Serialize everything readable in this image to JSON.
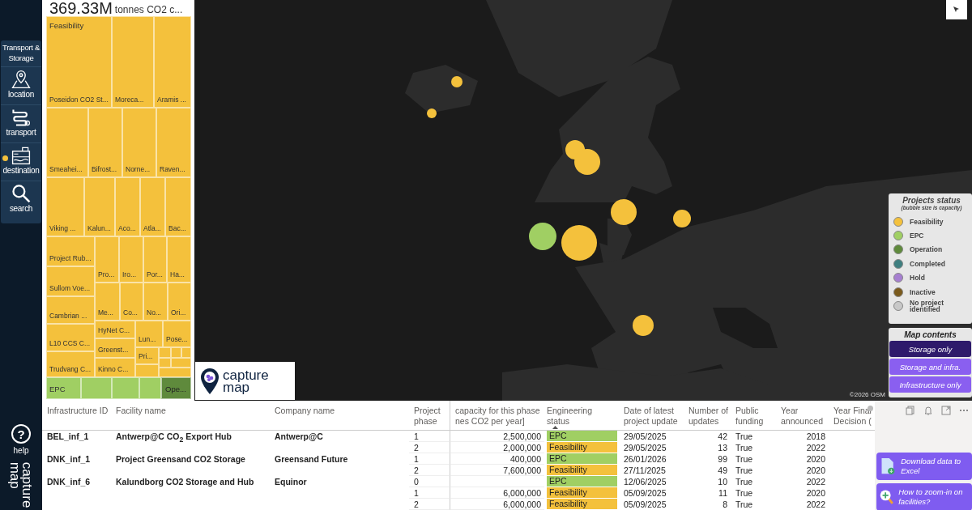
{
  "sidebar": {
    "nav_title": "Transport & Storage",
    "nav_items": [
      {
        "label": "location",
        "kind": "location",
        "selected": false
      },
      {
        "label": "transport",
        "kind": "transport",
        "selected": false
      },
      {
        "label": "destination",
        "kind": "destination",
        "selected": true
      },
      {
        "label": "search",
        "kind": "search",
        "selected": false
      }
    ],
    "help": {
      "glyph": "?",
      "label": "help"
    },
    "logo_lines": [
      "capture",
      "map"
    ]
  },
  "summary": {
    "value": "369.33M",
    "unit": "tonnes CO2 c..."
  },
  "treemap": {
    "groups": [
      {
        "label": "Feasibility",
        "color": "#f4c13c",
        "cells": [
          {
            "label": "Poseidon CO2 St..."
          },
          {
            "label": "Moreca..."
          },
          {
            "label": "Aramis ..."
          },
          {
            "label": "Smeahei..."
          },
          {
            "label": "Bifrost..."
          },
          {
            "label": "Norne..."
          },
          {
            "label": "Raven..."
          },
          {
            "label": "Viking ..."
          },
          {
            "label": "Kalun..."
          },
          {
            "label": "Aco..."
          },
          {
            "label": "Atla..."
          },
          {
            "label": "Bac..."
          },
          {
            "label": "Project Rub..."
          },
          {
            "label": "Sullom Voe..."
          },
          {
            "label": "Cambrian ..."
          },
          {
            "label": "L10 CCS C..."
          },
          {
            "label": "Trudvang C..."
          },
          {
            "label": "Pro..."
          },
          {
            "label": "Iro..."
          },
          {
            "label": "Por..."
          },
          {
            "label": "Ha..."
          },
          {
            "label": "Me..."
          },
          {
            "label": "Co..."
          },
          {
            "label": "No..."
          },
          {
            "label": "Ori..."
          },
          {
            "label": "HyNet C..."
          },
          {
            "label": "Greenst..."
          },
          {
            "label": "Kinno C..."
          },
          {
            "label": "Lun..."
          },
          {
            "label": "Pose..."
          },
          {
            "label": "Pri..."
          },
          {},
          {},
          {},
          {},
          {},
          {},
          {}
        ]
      },
      {
        "label": "EPC",
        "color": "#a0cf63",
        "cells": [
          {},
          {},
          {},
          {}
        ]
      },
      {
        "label": "Ope...",
        "color": "#5f8a3c",
        "cells": [
          {}
        ]
      }
    ]
  },
  "map": {
    "kind": "picture",
    "attribution": "©2026 OSM"
  },
  "legend": {
    "title": "Projects status",
    "subtitle": "(bubble size is capacity)",
    "items": [
      {
        "label": "Feasibility",
        "color": "#f4c13c"
      },
      {
        "label": "EPC",
        "color": "#a0cf63"
      },
      {
        "label": "Operation",
        "color": "#5f8a3c"
      },
      {
        "label": "Completed",
        "color": "#3f7f80"
      },
      {
        "label": "Hold",
        "color": "#a67fd0"
      },
      {
        "label": "Inactive",
        "color": "#7a5a1c"
      },
      {
        "label": "No project identified",
        "color": "#c8c8c8"
      }
    ]
  },
  "map_contents": {
    "title": "Map contents",
    "options": [
      {
        "label": "Storage only",
        "selected": true
      },
      {
        "label": "Storage and infra.",
        "selected": false
      },
      {
        "label": "Infrastructure only",
        "selected": false
      }
    ]
  },
  "map_logo": {
    "lines": [
      "capture",
      "map"
    ]
  },
  "table": {
    "columns": [
      {
        "lines": [
          "Infrastructure ID"
        ]
      },
      {
        "lines": [
          "Facility name"
        ]
      },
      {
        "lines": [
          "Company name"
        ]
      },
      {
        "lines": [
          "Project",
          "phase"
        ]
      },
      {
        "lines": [
          "capacity for this phase",
          "nes CO2 per year]"
        ]
      },
      {
        "lines": [
          "Engineering",
          "status"
        ],
        "sorted": true
      },
      {
        "lines": [
          "Date of latest",
          "project update"
        ]
      },
      {
        "lines": [
          "Number of",
          "updates"
        ]
      },
      {
        "lines": [
          "Public",
          "funding"
        ]
      },
      {
        "lines": [
          "Year",
          "announced"
        ]
      },
      {
        "lines": [
          "Year Final",
          "Decision ("
        ]
      }
    ],
    "facilities": [
      {
        "id": "BEL_inf_1",
        "name": "Antwerp@C CO$_{2}$ Export Hub",
        "company": "Antwerp@C",
        "phases": [
          {
            "phase": "1",
            "capacity": "2,500,000",
            "status": {
              "text": "EPC",
              "color": "#a0cf63"
            },
            "date": "29/05/2025",
            "updates": "42",
            "funding": "True",
            "year": "2018"
          },
          {
            "phase": "2",
            "capacity": "2,000,000",
            "status": {
              "text": "Feasibility",
              "color": "#f4c13c"
            },
            "date": "29/05/2025",
            "updates": "13",
            "funding": "True",
            "year": "2022"
          }
        ]
      },
      {
        "id": "DNK_inf_1",
        "name": "Project Greensand CO2 Storage",
        "company": "Greensand Future",
        "phases": [
          {
            "phase": "1",
            "capacity": "400,000",
            "status": {
              "text": "EPC",
              "color": "#a0cf63"
            },
            "date": "26/01/2026",
            "updates": "99",
            "funding": "True",
            "year": "2020"
          },
          {
            "phase": "2",
            "capacity": "7,600,000",
            "status": {
              "text": "Feasibility",
              "color": "#f4c13c"
            },
            "date": "27/11/2025",
            "updates": "49",
            "funding": "True",
            "year": "2020"
          }
        ]
      },
      {
        "id": "DNK_inf_6",
        "name": "Kalundborg CO2 Storage and Hub",
        "company": "Equinor",
        "phases": [
          {
            "phase": "0",
            "status": {
              "text": "EPC",
              "color": "#a0cf63"
            },
            "date": "12/06/2025",
            "updates": "10",
            "funding": "True",
            "year": "2022"
          },
          {
            "phase": "1",
            "capacity": "6,000,000",
            "status": {
              "text": "Feasibility",
              "color": "#f4c13c"
            },
            "date": "05/09/2025",
            "updates": "11",
            "funding": "True",
            "year": "2020"
          },
          {
            "phase": "2",
            "capacity": "6,000,000",
            "status": {
              "text": "Feasibility",
              "color": "#f4c13c"
            },
            "date": "05/09/2025",
            "updates": "8",
            "funding": "True",
            "year": "2022"
          }
        ]
      }
    ]
  },
  "actions": [
    {
      "label": "Download data to Excel",
      "kind": "download"
    },
    {
      "label": "How to zoom-in on facilities?",
      "kind": "zoom"
    }
  ]
}
